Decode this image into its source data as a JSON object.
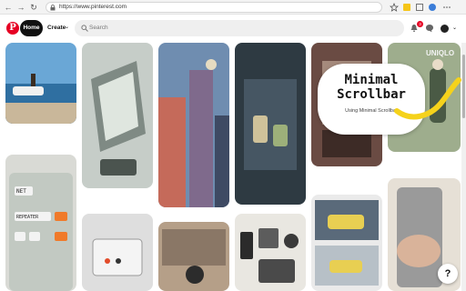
{
  "browser": {
    "url": "https://www.pinterest.com",
    "back_glyph": "←",
    "reload_glyph": "↻"
  },
  "header": {
    "logo_letter": "P",
    "home_label": "Home",
    "create_label": "Create",
    "search_placeholder": "Search",
    "notification_count": "3",
    "chevron": "⌄"
  },
  "colors": {
    "brand": "#e60023",
    "accent_yellow": "#f5d21b"
  },
  "extension_card": {
    "title": "Minimal Scrollbar",
    "subtitle": "Using Minimal Scrollbar"
  },
  "pins": [
    {
      "name": "pin-car-shore",
      "description": "white car on pier by the sea"
    },
    {
      "name": "pin-laptop-illustration",
      "description": "retro laptop illustration"
    },
    {
      "name": "pin-street-night",
      "description": "anime street at dusk"
    },
    {
      "name": "pin-cafe-cups",
      "description": "drink cups in dark room"
    },
    {
      "name": "pin-window-room",
      "description": "room with window"
    },
    {
      "name": "pin-uniqlo-figure",
      "description": "Uniqlo illustration"
    },
    {
      "name": "pin-keyboard-keys",
      "description": "mechanical keyboard keys"
    },
    {
      "name": "pin-device-box",
      "description": "transparent device"
    },
    {
      "name": "pin-desk-study",
      "description": "study desk illustration"
    },
    {
      "name": "pin-flatlay",
      "description": "flatlay of items"
    },
    {
      "name": "pin-car-comic",
      "description": "yellow car comic"
    },
    {
      "name": "pin-hand-keyboard",
      "description": "hand with keyboard"
    }
  ],
  "keycaps": [
    "NET",
    "REPEATER"
  ],
  "uniqlo_text": "UNIQLO",
  "help_label": "?"
}
